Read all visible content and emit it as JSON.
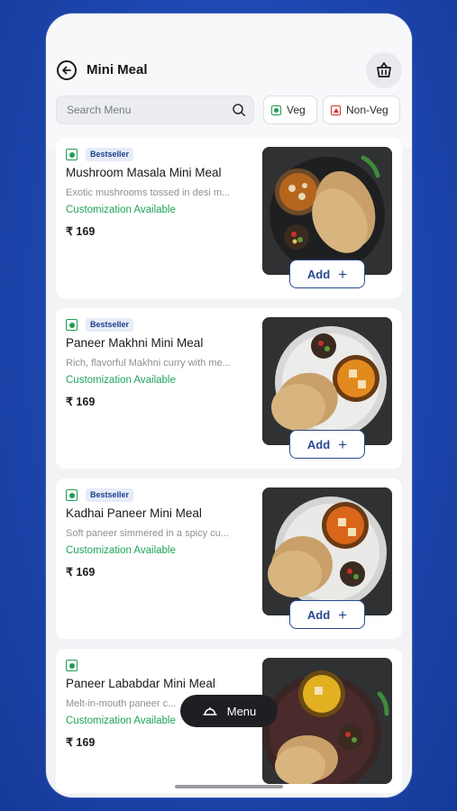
{
  "header": {
    "title": "Mini Meal"
  },
  "search": {
    "placeholder": "Search Menu"
  },
  "filters": [
    {
      "label": "Veg",
      "type": "veg"
    },
    {
      "label": "Non-Veg",
      "type": "non-veg"
    }
  ],
  "items": [
    {
      "badge": "Bestseller",
      "name": "Mushroom Masala Mini Meal",
      "desc": "Exotic mushrooms tossed in desi m...",
      "customization": "Customization Available",
      "price": "₹ 169",
      "add_label": "Add"
    },
    {
      "badge": "Bestseller",
      "name": "Paneer Makhni Mini Meal",
      "desc": "Rich, flavorful Makhni curry with me...",
      "customization": "Customization Available",
      "price": "₹ 169",
      "add_label": "Add"
    },
    {
      "badge": "Bestseller",
      "name": "Kadhai Paneer Mini Meal",
      "desc": "Soft paneer simmered in a spicy cu...",
      "customization": "Customization Available",
      "price": "₹ 169",
      "add_label": "Add"
    },
    {
      "badge": "",
      "name": "Paneer Lababdar Mini Meal",
      "desc": "Melt-in-mouth paneer c...",
      "customization": "Customization Available",
      "price": "₹ 169",
      "add_label": ""
    }
  ],
  "fab": {
    "label": "Menu"
  },
  "colors": {
    "accent": "#26498f",
    "veg": "#1f9d55",
    "nonveg": "#d0302b",
    "customization": "#1fa35a"
  },
  "icons": [
    "back-arrow-icon",
    "cart-icon",
    "search-icon",
    "veg-icon",
    "non-veg-icon",
    "plus-icon",
    "cloche-icon"
  ]
}
